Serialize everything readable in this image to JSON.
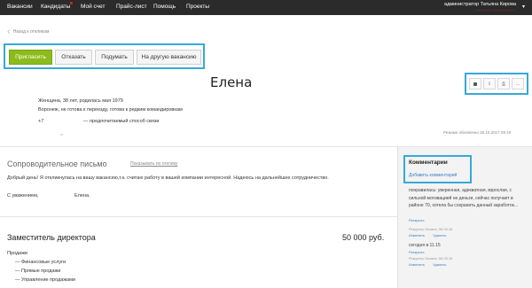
{
  "nav": {
    "items": [
      "Вакансии",
      "Кандидаты",
      "Мой счет",
      "Прайс-лист",
      "Помощь",
      "Проекты"
    ],
    "admin_name": "администратор Татьяна Кирова",
    "admin_sub": "———— ——————"
  },
  "back": {
    "label": "Назад к откликам"
  },
  "actions": {
    "invite": "Пригласить",
    "reject": "Отказать",
    "think": "Подумать",
    "other_vacancy": "На другую вакансию"
  },
  "tools": {
    "more_label": "..."
  },
  "candidate": {
    "name": "Елена",
    "line1": "Женщина, 38 лет, родилась          мая 1979",
    "line2": "Воронеж, не готова к переезду, готова к редким командировкам",
    "phone_code": "+7",
    "phone_note": "— предпочитаемый способ связи",
    "updated": "Резюме обновлено 25.10.2017 08:19"
  },
  "cover_letter": {
    "title": "Сопроводительное письмо",
    "toggle": "Показывать по отклику",
    "text": "Добрый день! Я откликнулась на вашу вакансию,т.к. считаю работу в вашей компании интересной. Надеюсь на дальнейшее сотрудничество.",
    "sign": "С уважением,",
    "sign_name": "Елена."
  },
  "position": {
    "title": "Заместитель директора",
    "salary": "50 000 руб.",
    "area": "Продажи",
    "subareas": [
      "— Финансовые услуги",
      "— Прямые продажи",
      "— Управление продажами"
    ]
  },
  "comments": {
    "title": "Комментарии",
    "add": "Добавить комментарий",
    "items": [
      {
        "text": "понравилась: уверенная, адекватная, взрослая, с сильной мотивацией не деньги, сейчас получает в районе 70, хотела бы сохранить данный заработок...",
        "action": "Раскрыть",
        "meta": "Рекрутер Оксана, 06.05.16",
        "links": [
          "Изменить",
          "Удалить"
        ]
      },
      {
        "text": "сегодня в 11.15",
        "action": "Раскрыть",
        "meta": "Рекрутер Оксана, 06.05.16",
        "links": [
          "Изменить",
          "Удалить"
        ]
      }
    ]
  },
  "colors": {
    "topbar": "#2b2b2b",
    "accent_green": "#8cbc1c",
    "highlight_blue": "#36a9d9",
    "link_blue": "#3d7fc2",
    "notify_red": "#e02020"
  }
}
